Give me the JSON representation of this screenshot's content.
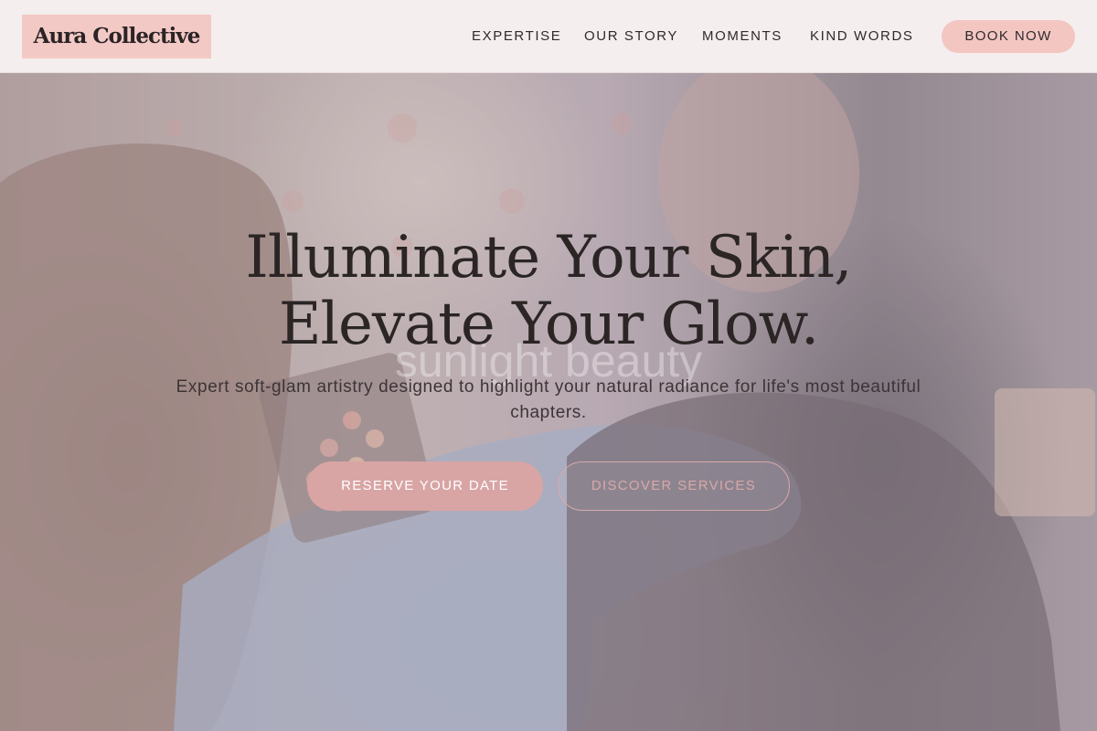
{
  "brand": {
    "name": "Aura Collective"
  },
  "nav": {
    "items": [
      {
        "label": "EXPERTISE"
      },
      {
        "label": "OUR STORY"
      },
      {
        "label": "MOMENTS"
      },
      {
        "label": "KIND WORDS"
      }
    ],
    "cta_label": "BOOK NOW"
  },
  "hero": {
    "title_line1": "Illuminate Your Skin,",
    "title_line2": "Elevate Your Glow.",
    "subtitle": "Expert soft-glam artistry designed to highlight your natural radiance for life's most beautiful chapters.",
    "watermark": "sunlight beauty",
    "primary_cta": "RESERVE YOUR DATE",
    "secondary_cta": "DISCOVER SERVICES"
  },
  "colors": {
    "header_bg": "#f5eeee",
    "logo_bg": "#f3c9c5",
    "accent_pink": "#f3c6c2",
    "primary_button": "#d8a5a4",
    "text_dark": "#2b2525"
  }
}
